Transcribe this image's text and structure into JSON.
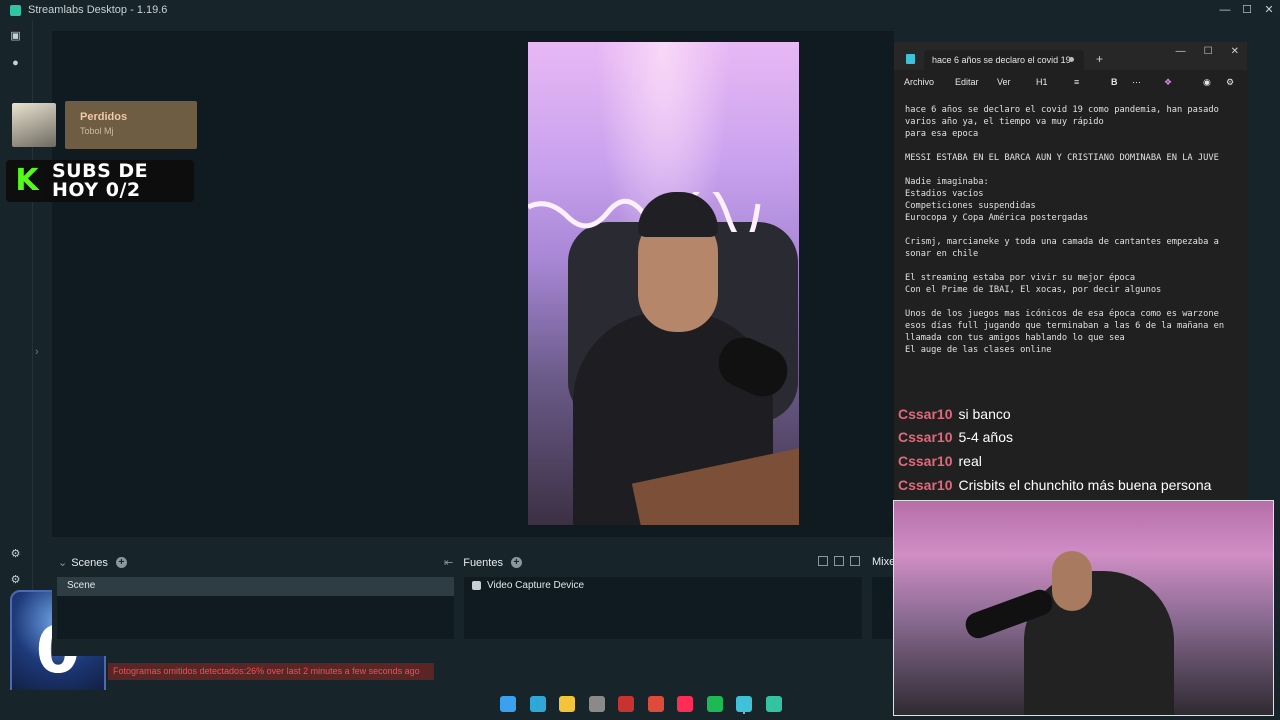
{
  "window": {
    "title": "Streamlabs Desktop - 1.19.6"
  },
  "now_playing": {
    "title": "Perdidos",
    "artist": "Tobol Mj"
  },
  "subs_goal": {
    "line1": "SUBS DE",
    "line2": "HOY 0/2",
    "logo": "K"
  },
  "counter": {
    "value": "0"
  },
  "dock": {
    "scenes_label": "Scenes",
    "scene_items": [
      "Scene"
    ],
    "sources_label": "Fuentes",
    "source_items": [
      "Video Capture Device"
    ],
    "mixer_label": "Mixe"
  },
  "status": {
    "dropped_frames": "Fotogramas omitidos detectados:26% over last 2 minutes a few seconds ago"
  },
  "notepad": {
    "tab_title": "hace 6 años se declaro el covid 19",
    "menus": [
      "Archivo",
      "Editar",
      "Ver"
    ],
    "heading_menu": "H1",
    "bold": "B",
    "text": "hace 6 años se declaro el covid 19 como pandemia, han pasado\nvarios año ya, el tiempo va muy rápido\npara esa epoca\n\nMESSI ESTABA EN EL BARCA AUN Y CRISTIANO DOMINABA EN LA JUVE\n\nNadie imaginaba:\nEstadios vacíos\nCompeticiones suspendidas\nEurocopa y Copa América postergadas\n\nCrismj, marcianeke y toda una camada de cantantes empezaba a\nsonar en chile\n\nEl streaming estaba por vivir su mejor época\nCon el Prime de IBAI, El xocas, por decir algunos\n\nUnos de los juegos mas icónicos de esa época como es warzone\nesos días full jugando que terminaban a las 6 de la mañana en\nllamada con tus amigos hablando lo que sea\nEl auge de las clases online"
  },
  "chat": [
    {
      "user": "Cssar10",
      "msg": "si banco"
    },
    {
      "user": "Cssar10",
      "msg": "5-4 años"
    },
    {
      "user": "Cssar10",
      "msg": "real"
    },
    {
      "user": "Cssar10",
      "msg": "Crisbits el chunchito más buena persona"
    }
  ],
  "taskbar": {
    "icons": [
      "windows-start-icon",
      "edge-icon",
      "file-explorer-icon",
      "xbox-icon",
      "news-icon",
      "chrome-icon",
      "tiktok-icon",
      "spotify-icon",
      "notepad-icon",
      "streamlabs-icon"
    ],
    "colors": [
      "#3aa0f0",
      "#2fa8d8",
      "#f3c338",
      "#8a8a8a",
      "#c8322f",
      "#e04a3a",
      "#ff2d55",
      "#1db954",
      "#3fc1d9",
      "#31c3a2"
    ]
  }
}
